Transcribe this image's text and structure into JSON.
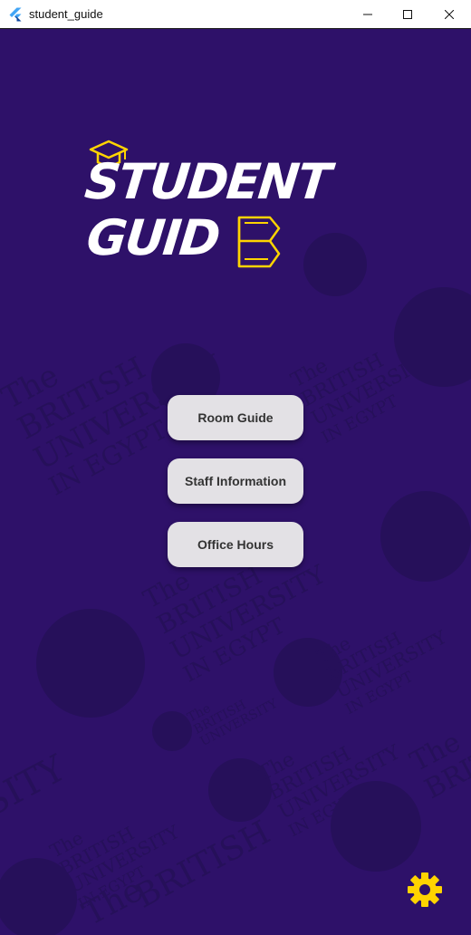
{
  "window": {
    "title": "student_guide"
  },
  "logo": {
    "line1": "STUDENT",
    "line2": "GUID"
  },
  "watermark": {
    "the": "The",
    "british": "BRITISH",
    "university": "UNIVERSITY",
    "in_egypt": "IN EGYPT",
    "big_word": "SITY"
  },
  "menu": {
    "room_guide": "Room Guide",
    "staff_information": "Staff Information",
    "office_hours": "Office Hours"
  },
  "colors": {
    "background": "#2e1169",
    "accent": "#ffd400",
    "button": "#e3e1e5"
  },
  "icons": {
    "app": "flutter-icon",
    "cap": "graduation-cap-icon",
    "book": "open-book-icon",
    "settings": "gear-icon"
  }
}
